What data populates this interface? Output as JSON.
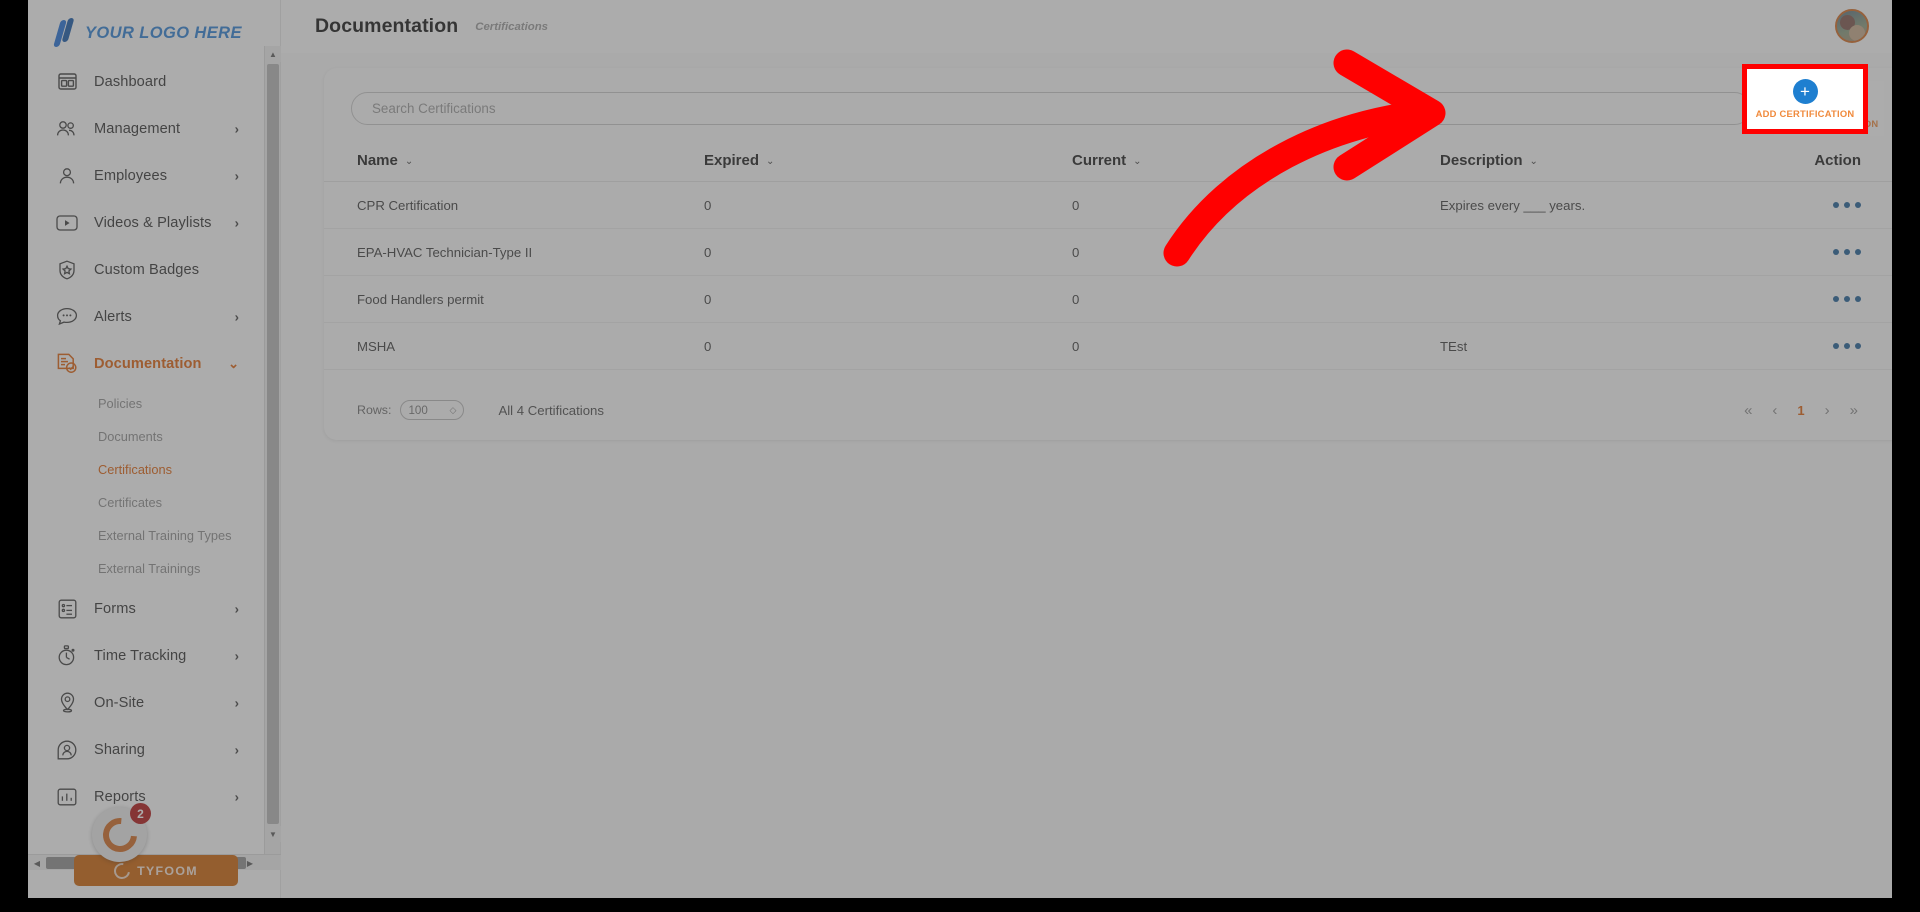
{
  "brand": {
    "logo_text": "YOUR LOGO HERE",
    "logo_color": "#2a7fd4",
    "accent_color": "#e0600a",
    "link_color": "#1e7fd0",
    "highlight_color": "#ff0000"
  },
  "header": {
    "title": "Documentation",
    "subtitle": "Certifications"
  },
  "sidebar": {
    "items": [
      {
        "label": "Dashboard",
        "icon": "dashboard-icon",
        "expandable": false,
        "active": false
      },
      {
        "label": "Management",
        "icon": "management-icon",
        "expandable": true,
        "active": false
      },
      {
        "label": "Employees",
        "icon": "employees-icon",
        "expandable": true,
        "active": false
      },
      {
        "label": "Videos & Playlists",
        "icon": "video-icon",
        "expandable": true,
        "active": false
      },
      {
        "label": "Custom Badges",
        "icon": "badge-shield-icon",
        "expandable": false,
        "active": false
      },
      {
        "label": "Alerts",
        "icon": "alerts-chat-icon",
        "expandable": true,
        "active": false
      },
      {
        "label": "Documentation",
        "icon": "documentation-icon",
        "expandable": true,
        "active": true
      },
      {
        "label": "Forms",
        "icon": "forms-icon",
        "expandable": true,
        "active": false
      },
      {
        "label": "Time Tracking",
        "icon": "stopwatch-icon",
        "expandable": true,
        "active": false
      },
      {
        "label": "On-Site",
        "icon": "map-pin-icon",
        "expandable": true,
        "active": false
      },
      {
        "label": "Sharing",
        "icon": "sharing-person-icon",
        "expandable": true,
        "active": false
      },
      {
        "label": "Reports",
        "icon": "reports-bar-icon",
        "expandable": true,
        "active": false
      }
    ],
    "documentation_subitems": [
      {
        "label": "Policies",
        "active": false
      },
      {
        "label": "Documents",
        "active": false
      },
      {
        "label": "Certifications",
        "active": true
      },
      {
        "label": "Certificates",
        "active": false
      },
      {
        "label": "External Training Types",
        "active": false
      },
      {
        "label": "External Trainings",
        "active": false
      }
    ],
    "tyfoom": {
      "label": "TYFOOM",
      "notification_count": "2"
    }
  },
  "toolbar": {
    "search_placeholder": "Search Certifications",
    "search_value": "",
    "add_button_label": "ADD CERTIFICATION",
    "add_button_icon": "plus-icon"
  },
  "table": {
    "columns": [
      {
        "label": "Name",
        "sortable": true
      },
      {
        "label": "Expired",
        "sortable": true
      },
      {
        "label": "Current",
        "sortable": true
      },
      {
        "label": "Description",
        "sortable": true
      },
      {
        "label": "Action",
        "sortable": false
      }
    ],
    "rows": [
      {
        "name": "CPR Certification",
        "expired": "0",
        "current": "0",
        "description": "Expires every ___ years."
      },
      {
        "name": "EPA-HVAC Technician-Type II",
        "expired": "0",
        "current": "0",
        "description": ""
      },
      {
        "name": "Food Handlers permit",
        "expired": "0",
        "current": "0",
        "description": ""
      },
      {
        "name": "MSHA",
        "expired": "0",
        "current": "0",
        "description": "TEst"
      }
    ]
  },
  "footer": {
    "rows_label": "Rows:",
    "rows_value": "100",
    "total_label": "All 4 Certifications",
    "pager": {
      "first": "«",
      "prev": "‹",
      "current_page": "1",
      "next": "›",
      "last": "»"
    }
  },
  "annotation": {
    "type": "curved-arrow",
    "points_to": "ADD CERTIFICATION",
    "color": "#ff0000"
  }
}
